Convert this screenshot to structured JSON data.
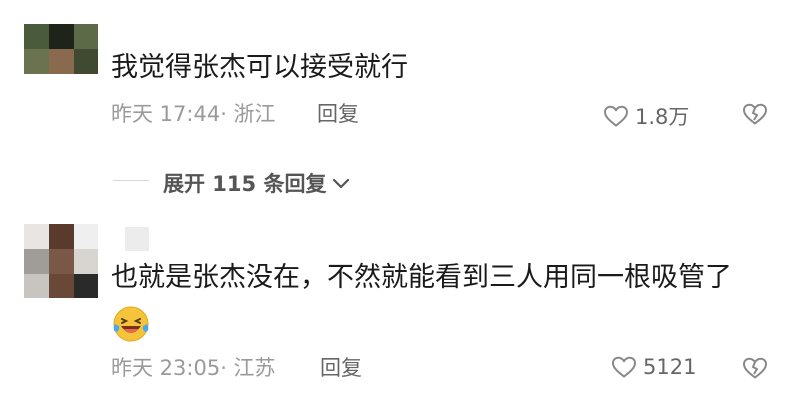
{
  "comments": [
    {
      "text": "我觉得张杰可以接受就行",
      "time_location": "昨天 17:44· 浙江",
      "reply_label": "回复",
      "like_count": "1.8万"
    },
    {
      "text": "也就是张杰没在，不然就能看到三人用同一根吸管了",
      "emoji_icon": "laughing-tears-emoji",
      "time_location": "昨天 23:05· 江苏",
      "reply_label": "回复",
      "like_count": "5121"
    }
  ],
  "expand_replies": {
    "label": "展开 115 条回复"
  },
  "icons": {
    "like": "heart-outline-icon",
    "dislike": "broken-heart-icon",
    "chevron": "chevron-down-icon"
  },
  "colors": {
    "text": "#1a1a1a",
    "meta": "#9a9a9a",
    "action": "#666666"
  }
}
